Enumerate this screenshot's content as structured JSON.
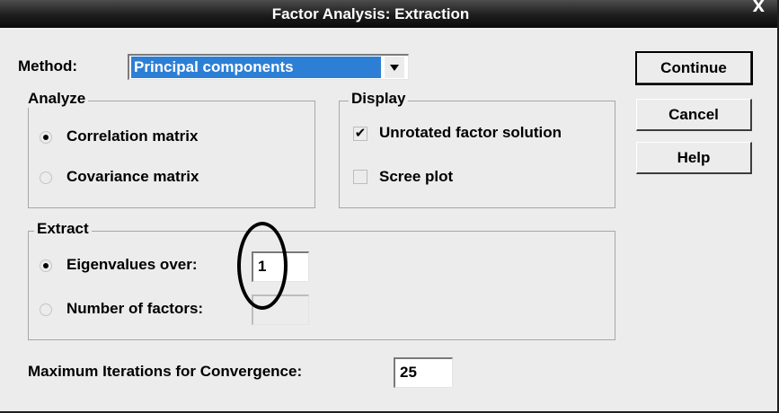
{
  "window": {
    "title": "Factor Analysis: Extraction",
    "close_glyph": "x"
  },
  "method": {
    "label": "Method:",
    "selected": "Principal components"
  },
  "buttons": {
    "continue": "Continue",
    "cancel": "Cancel",
    "help": "Help"
  },
  "analyze": {
    "title": "Analyze",
    "options": [
      {
        "label": "Correlation matrix",
        "checked": true
      },
      {
        "label": "Covariance matrix",
        "checked": false
      }
    ]
  },
  "display": {
    "title": "Display",
    "options": [
      {
        "label": "Unrotated factor solution",
        "checked": true
      },
      {
        "label": "Scree plot",
        "checked": false
      }
    ]
  },
  "extract": {
    "title": "Extract",
    "eigen": {
      "label": "Eigenvalues over:",
      "value": "1",
      "checked": true
    },
    "factors": {
      "label": "Number of factors:",
      "value": "",
      "checked": false
    }
  },
  "iterations": {
    "label": "Maximum Iterations for Convergence:",
    "value": "25"
  },
  "check_glyph": "✔"
}
